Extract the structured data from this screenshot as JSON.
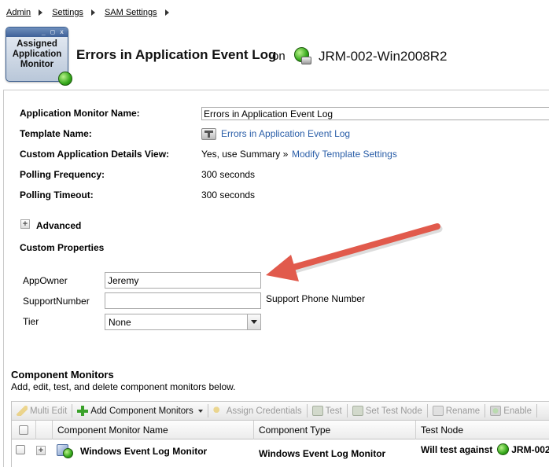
{
  "breadcrumb": [
    "Admin",
    "Settings",
    "SAM Settings"
  ],
  "badge": {
    "line1": "Assigned",
    "line2": "Application",
    "line3": "Monitor",
    "controls": "_ □ x"
  },
  "header": {
    "title": "Errors in Application Event Log",
    "on": "on",
    "node": "JRM-002-Win2008R2"
  },
  "properties": {
    "monitor_name_label": "Application Monitor Name:",
    "monitor_name_value": "Errors in Application Event Log",
    "template_label": "Template Name:",
    "template_value": "Errors in Application Event Log",
    "details_label": "Custom Application Details View:",
    "details_value": "Yes, use Summary »",
    "details_link": "Modify Template Settings",
    "polling_freq_label": "Polling Frequency:",
    "polling_freq_value": "300 seconds",
    "polling_timeout_label": "Polling Timeout:",
    "polling_timeout_value": "300 seconds"
  },
  "advanced": {
    "label": "Advanced",
    "expander": "+"
  },
  "custom_properties": {
    "title": "Custom Properties",
    "app_owner_label": "AppOwner",
    "app_owner_value": "Jeremy",
    "support_label": "SupportNumber",
    "support_value": "",
    "support_hint": "Support Phone Number",
    "tier_label": "Tier",
    "tier_value": "None"
  },
  "component_monitors": {
    "title": "Component Monitors",
    "description": "Add, edit, test, and delete component monitors below.",
    "toolbar": {
      "multi_edit": "Multi Edit",
      "add": "Add Component Monitors",
      "assign": "Assign Credentials",
      "test": "Test",
      "set_test_node": "Set Test Node",
      "rename": "Rename",
      "enable": "Enable"
    },
    "columns": {
      "name": "Component Monitor Name",
      "type": "Component Type",
      "test_node": "Test Node"
    },
    "rows": [
      {
        "expander": "+",
        "name": "Windows Event Log Monitor",
        "type": "Windows Event Log Monitor",
        "test_prefix": "Will test against",
        "test_node": "JRM-002"
      }
    ]
  },
  "colors": {
    "accent": "#2a5ea8",
    "arrow": "#e15a4c",
    "status_green": "#34a81a"
  }
}
